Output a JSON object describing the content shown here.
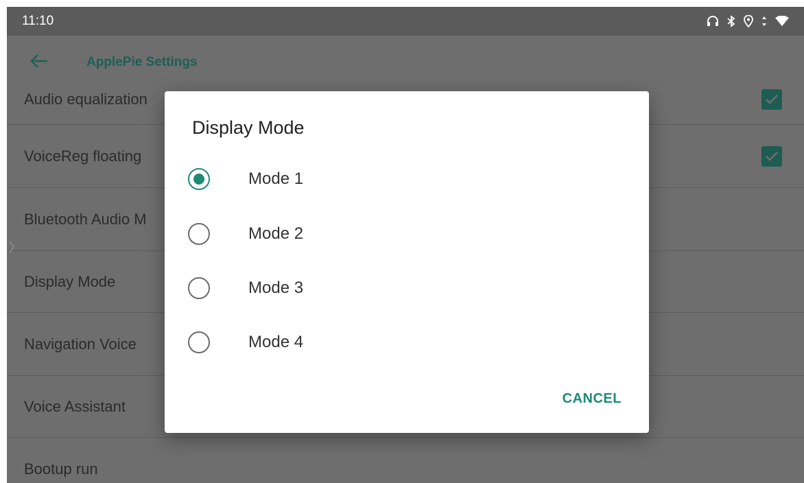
{
  "status_bar": {
    "time": "11:10",
    "icons": [
      "headphones-icon",
      "bluetooth-icon",
      "location-icon",
      "data-arrows-icon",
      "wifi-icon"
    ]
  },
  "app_bar": {
    "title": "ApplePie Settings",
    "back_icon": "arrow-left-icon"
  },
  "settings": {
    "items": [
      {
        "label": "Audio equalization",
        "checked": true
      },
      {
        "label": "VoiceReg floating",
        "checked": true
      },
      {
        "label": "Bluetooth Audio M"
      },
      {
        "label": "Display Mode"
      },
      {
        "label": "Navigation Voice"
      },
      {
        "label": "Voice Assistant"
      },
      {
        "label": "Bootup run"
      }
    ]
  },
  "dialog": {
    "title": "Display Mode",
    "options": [
      {
        "label": "Mode 1",
        "selected": true
      },
      {
        "label": "Mode 2",
        "selected": false
      },
      {
        "label": "Mode 3",
        "selected": false
      },
      {
        "label": "Mode 4",
        "selected": false
      }
    ],
    "cancel_label": "CANCEL"
  },
  "colors": {
    "accent": "#1e8a78",
    "scrim": "#6e6e6e",
    "status_bar": "#5b5b5b"
  }
}
